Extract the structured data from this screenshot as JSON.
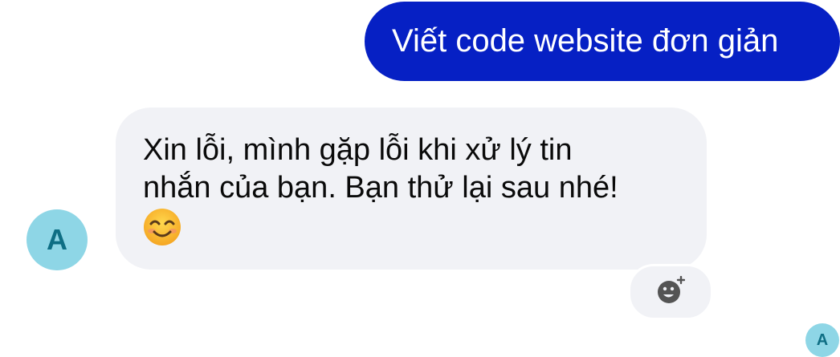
{
  "messages": {
    "sent_text": "Viết code website đơn giản",
    "received_line1": "Xin lỗi, mình gặp lỗi khi xử lý tin",
    "received_line2": "nhắn của bạn. Bạn thử lại sau nhé!"
  },
  "avatar": {
    "initial": "A",
    "read_receipt_initial": "A"
  },
  "icons": {
    "emoji": "smiling-face-with-smiling-eyes",
    "reaction": "add-reaction-icon"
  },
  "colors": {
    "sent_bubble": "#0620c4",
    "received_bubble": "#f1f2f6",
    "avatar_bg": "#8ed6e6",
    "avatar_text": "#0e6e84"
  }
}
